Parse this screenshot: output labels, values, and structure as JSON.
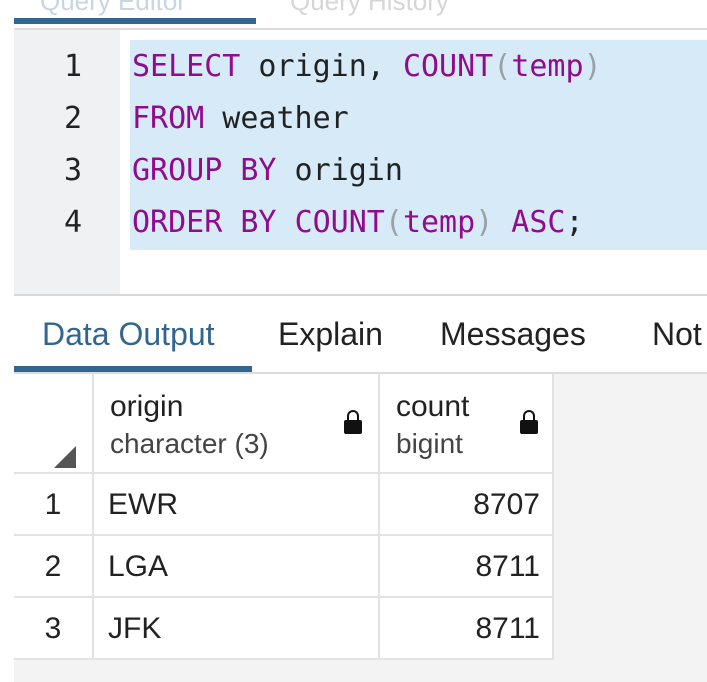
{
  "top_tabs": [
    {
      "label": "Query Editor",
      "active": true
    },
    {
      "label": "Query History",
      "active": false
    }
  ],
  "editor": {
    "line_numbers": [
      "1",
      "2",
      "3",
      "4"
    ],
    "lines": [
      [
        {
          "t": "SELECT",
          "c": "kw"
        },
        {
          "t": " origin, ",
          "c": "ident"
        },
        {
          "t": "COUNT",
          "c": "kw"
        },
        {
          "t": "(",
          "c": "paren"
        },
        {
          "t": "temp",
          "c": "kw"
        },
        {
          "t": ")",
          "c": "paren"
        }
      ],
      [
        {
          "t": "FROM",
          "c": "kw"
        },
        {
          "t": " weather",
          "c": "ident"
        }
      ],
      [
        {
          "t": "GROUP BY",
          "c": "kw"
        },
        {
          "t": " origin",
          "c": "ident"
        }
      ],
      [
        {
          "t": "ORDER BY ",
          "c": "kw"
        },
        {
          "t": "COUNT",
          "c": "kw"
        },
        {
          "t": "(",
          "c": "paren"
        },
        {
          "t": "temp",
          "c": "kw"
        },
        {
          "t": ")",
          "c": "paren"
        },
        {
          "t": " ASC",
          "c": "kw"
        },
        {
          "t": ";",
          "c": "ident"
        }
      ]
    ]
  },
  "output_tabs": {
    "data_output": "Data Output",
    "explain": "Explain",
    "messages": "Messages",
    "notifications": "Not"
  },
  "grid": {
    "columns": [
      {
        "name": "origin",
        "type": "character (3)"
      },
      {
        "name": "count",
        "type": "bigint"
      }
    ],
    "rows": [
      {
        "num": "1",
        "origin": "EWR",
        "count": "8707"
      },
      {
        "num": "2",
        "origin": "LGA",
        "count": "8711"
      },
      {
        "num": "3",
        "origin": "JFK",
        "count": "8711"
      }
    ]
  },
  "colors": {
    "accent": "#326690",
    "keyword": "#910b8d",
    "selection": "#d6ebf7"
  }
}
